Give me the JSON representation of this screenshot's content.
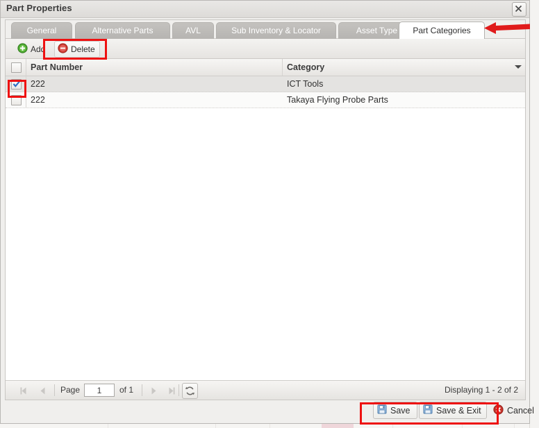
{
  "window": {
    "title": "Part Properties",
    "close_icon": "close-x-icon"
  },
  "tabs": [
    {
      "label": "General",
      "active": false
    },
    {
      "label": "Alternative Parts",
      "active": false
    },
    {
      "label": "AVL",
      "active": false
    },
    {
      "label": "Sub Inventory & Locator",
      "active": false
    },
    {
      "label": "Asset Type",
      "active": false
    },
    {
      "label": "Part Categories",
      "active": true
    }
  ],
  "toolbar": {
    "add_label": "Add",
    "add_icon": "circle-plus-icon",
    "delete_label": "Delete",
    "delete_icon": "circle-minus-icon"
  },
  "grid": {
    "columns": [
      {
        "key": "select",
        "label": ""
      },
      {
        "key": "part_number",
        "label": "Part Number"
      },
      {
        "key": "category",
        "label": "Category"
      }
    ],
    "column_menu_icon": "triangle-down-icon",
    "rows": [
      {
        "selected": true,
        "part_number": "222",
        "category": "ICT Tools"
      },
      {
        "selected": false,
        "part_number": "222",
        "category": "Takaya Flying Probe Parts"
      }
    ]
  },
  "pager": {
    "first_icon": "first-page-icon",
    "prev_icon": "prev-page-icon",
    "page_label": "Page",
    "page_value": "1",
    "of_label": "of 1",
    "next_icon": "next-page-icon",
    "last_icon": "last-page-icon",
    "refresh_icon": "refresh-icon",
    "status": "Displaying 1 - 2 of 2"
  },
  "footer": {
    "save_label": "Save",
    "save_icon": "floppy-disk-icon",
    "save_exit_label": "Save & Exit",
    "save_exit_icon": "floppy-disk-icon",
    "cancel_label": "Cancel",
    "cancel_icon": "red-x-circle-icon"
  },
  "annotations": {
    "arrow_color": "#e01b1b",
    "box_color": "#ee1111",
    "arrow_icon": "red-arrow-left-icon"
  }
}
